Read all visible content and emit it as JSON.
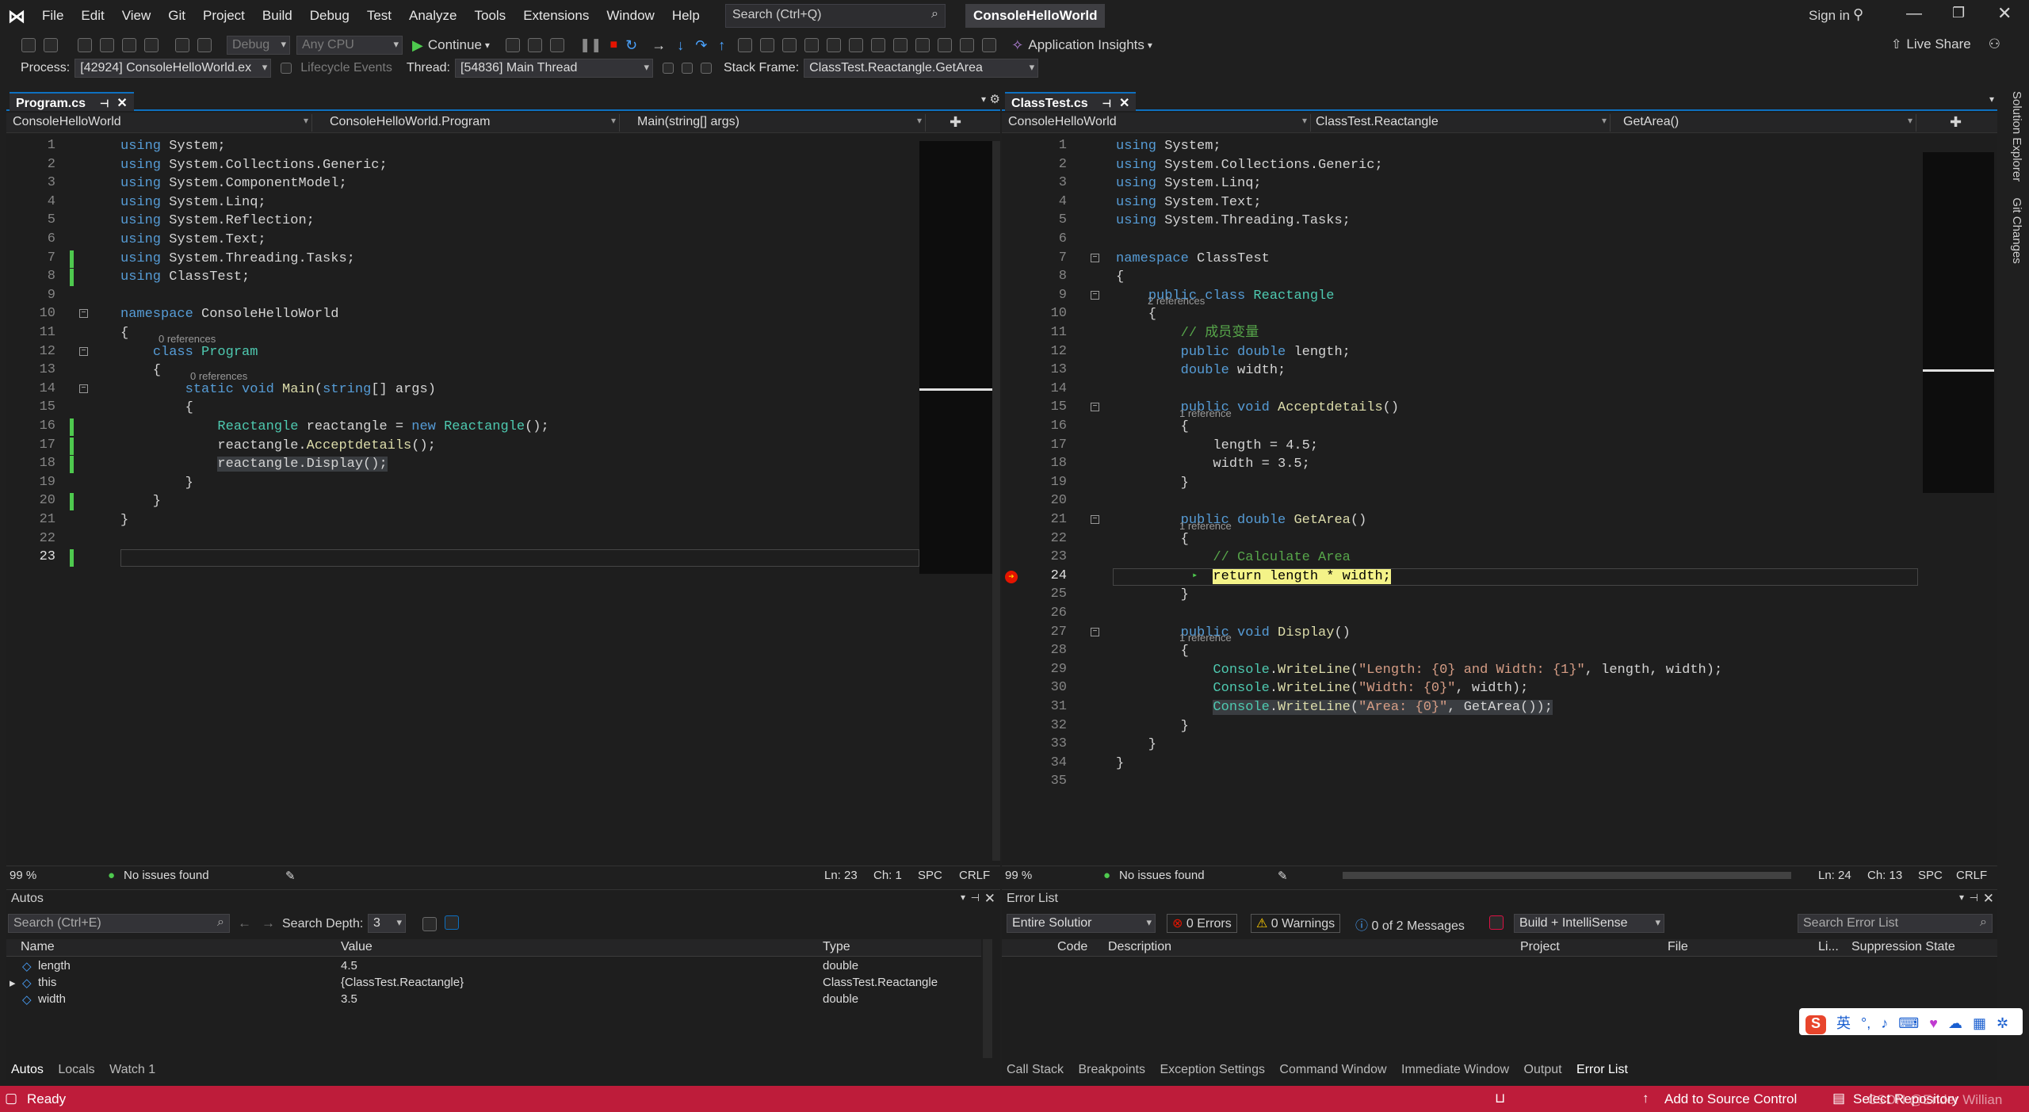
{
  "menu": [
    "File",
    "Edit",
    "View",
    "Git",
    "Project",
    "Build",
    "Debug",
    "Test",
    "Analyze",
    "Tools",
    "Extensions",
    "Window",
    "Help"
  ],
  "search_placeholder": "Search (Ctrl+Q)",
  "solution": "ConsoleHelloWorld",
  "signin": "Sign in",
  "toolbar": {
    "config": "Debug",
    "platform": "Any CPU",
    "continue": "Continue",
    "insights": "Application Insights",
    "liveshare": "Live Share"
  },
  "debugbar": {
    "process_label": "Process:",
    "process": "[42924] ConsoleHelloWorld.ex",
    "lifecycle": "Lifecycle Events",
    "thread_label": "Thread:",
    "thread": "[54836] Main Thread",
    "frame_label": "Stack Frame:",
    "frame": "ClassTest.Reactangle.GetArea"
  },
  "left": {
    "tab": "Program.cs",
    "nav": [
      "ConsoleHelloWorld",
      "ConsoleHelloWorld.Program",
      "Main(string[] args)"
    ],
    "status": {
      "zoom": "99 %",
      "issues": "No issues found",
      "ln": "Ln: 23",
      "ch": "Ch: 1",
      "spc": "SPC",
      "crlf": "CRLF"
    }
  },
  "right": {
    "tab": "ClassTest.cs",
    "nav": [
      "ConsoleHelloWorld",
      "ClassTest.Reactangle",
      "GetArea()"
    ],
    "status": {
      "zoom": "99 %",
      "issues": "No issues found",
      "ln": "Ln: 24",
      "ch": "Ch: 13",
      "spc": "SPC",
      "crlf": "CRLF"
    }
  },
  "autos": {
    "title": "Autos",
    "search": "Search (Ctrl+E)",
    "depth_label": "Search Depth:",
    "depth": "3",
    "cols": [
      "Name",
      "Value",
      "Type"
    ],
    "rows": [
      {
        "name": "length",
        "value": "4.5",
        "type": "double"
      },
      {
        "name": "this",
        "value": "{ClassTest.Reactangle}",
        "type": "ClassTest.Reactangle"
      },
      {
        "name": "width",
        "value": "3.5",
        "type": "double"
      }
    ],
    "tabs": [
      "Autos",
      "Locals",
      "Watch 1"
    ]
  },
  "errors": {
    "title": "Error List",
    "scope": "Entire Solutior",
    "errors": "0 Errors",
    "warnings": "0 Warnings",
    "messages": "0 of 2 Messages",
    "build": "Build + IntelliSense",
    "search": "Search Error List",
    "cols": [
      "Code",
      "Description",
      "Project",
      "File",
      "Li...",
      "Suppression State"
    ],
    "tabs": [
      "Call Stack",
      "Breakpoints",
      "Exception Settings",
      "Command Window",
      "Immediate Window",
      "Output",
      "Error List"
    ]
  },
  "vtabs": [
    "Solution Explorer",
    "Git Changes"
  ],
  "statusbar": {
    "ready": "Ready",
    "source": "Add to Source Control",
    "repo": "Select Repository",
    "watermark": "CSDN @Ender Willian"
  },
  "ime": "英"
}
